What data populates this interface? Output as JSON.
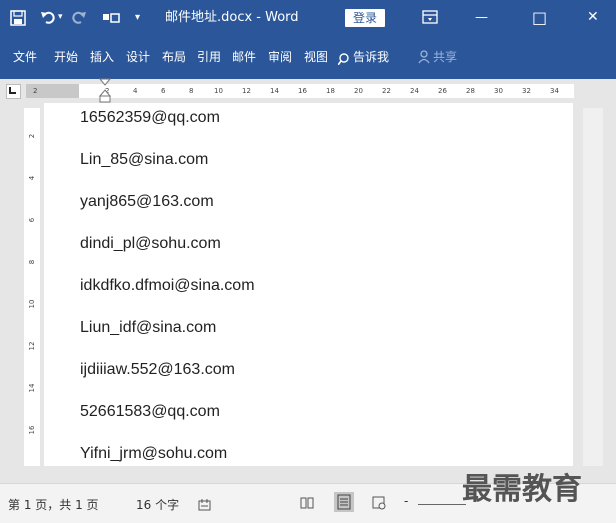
{
  "titlebar": {
    "doc_title": "邮件地址.docx  -  Word",
    "login_label": "登录",
    "qat_dropdown": "▾",
    "undo_dropdown": "▾",
    "minimize": "—",
    "maximize": "□",
    "close": "✕"
  },
  "ribbon": {
    "tabs": [
      "文件",
      "开始",
      "插入",
      "设计",
      "布局",
      "引用",
      "邮件",
      "审阅",
      "视图"
    ],
    "tell_me": "告诉我",
    "share": "共享"
  },
  "ruler": {
    "numbers": [
      "2",
      "2",
      "4",
      "6",
      "8",
      "10",
      "12",
      "14",
      "16",
      "18",
      "20",
      "22",
      "24",
      "26",
      "28",
      "30",
      "32",
      "34"
    ],
    "vertical_numbers": [
      "2",
      "4",
      "6",
      "8",
      "10",
      "12",
      "14",
      "16"
    ]
  },
  "document": {
    "emails": [
      "16562359@qq.com",
      "Lin_85@sina.com",
      "yanj865@163.com",
      "dindi_pl@sohu.com",
      "idkdfko.dfmoi@sina.com",
      "Liun_idf@sina.com",
      "ijdiiiaw.552@163.com",
      "52661583@qq.com",
      "Yifni_jrm@sohu.com"
    ]
  },
  "statusbar": {
    "page_info": "第 1 页，共 1 页",
    "word_count": "16 个字",
    "zoom_minus": "-"
  },
  "watermark": "最需教育",
  "colors": {
    "accent": "#2b579a"
  }
}
